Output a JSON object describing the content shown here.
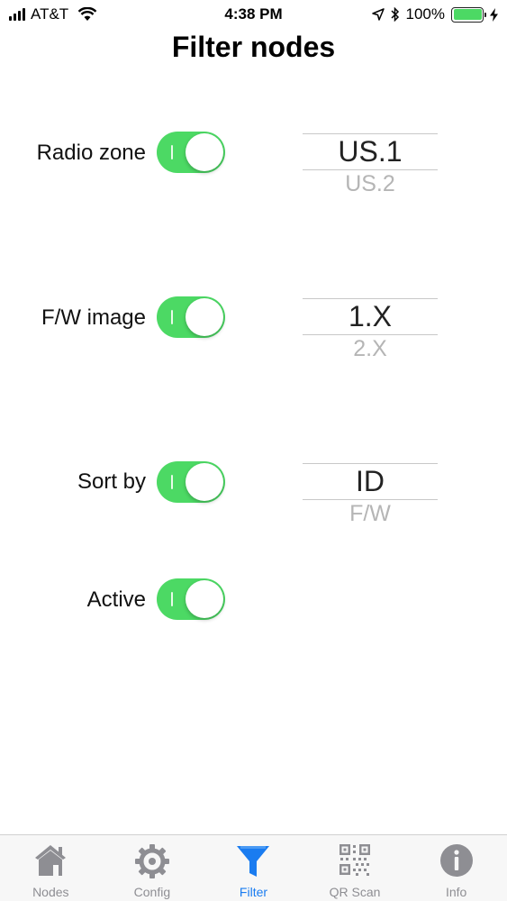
{
  "status_bar": {
    "carrier": "AT&T",
    "time": "4:38 PM",
    "battery_percent": "100%",
    "icons": [
      "signal-bars-icon",
      "wifi-icon",
      "location-arrow-icon",
      "bluetooth-icon",
      "battery-icon",
      "charging-bolt-icon"
    ]
  },
  "page": {
    "title": "Filter nodes"
  },
  "filters": [
    {
      "label": "Radio zone",
      "enabled": true,
      "picker_selected": "US.1",
      "picker_next": "US.2"
    },
    {
      "label": "F/W image",
      "enabled": true,
      "picker_selected": "1.X",
      "picker_next": "2.X"
    },
    {
      "label": "Sort by",
      "enabled": true,
      "picker_selected": "ID",
      "picker_next": "F/W"
    },
    {
      "label": "Active",
      "enabled": true
    }
  ],
  "tab_bar": {
    "tabs": [
      {
        "label": "Nodes",
        "icon": "house-icon"
      },
      {
        "label": "Config",
        "icon": "gear-icon"
      },
      {
        "label": "Filter",
        "icon": "funnel-icon",
        "active": true
      },
      {
        "label": "QR Scan",
        "icon": "qr-code-icon"
      },
      {
        "label": "Info",
        "icon": "info-icon"
      }
    ],
    "active_color": "#1a7cf0",
    "inactive_color": "#8e8e93"
  },
  "colors": {
    "toggle_on": "#4cd964"
  }
}
